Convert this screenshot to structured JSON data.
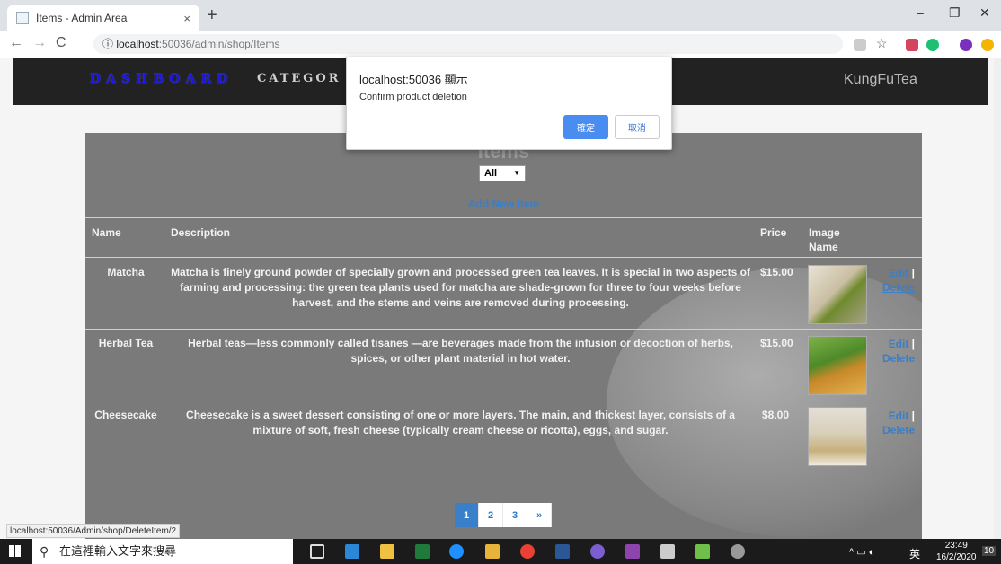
{
  "browser": {
    "tab_title": "Items - Admin Area",
    "tab_close": "×",
    "new_tab": "+",
    "url_host": "localhost",
    "url_path": ":50036/admin/shop/Items",
    "minimize": "–",
    "restore": "❐",
    "close": "✕"
  },
  "site": {
    "brand": "DASHBOARD",
    "nav_categories": "CATEGOR",
    "store_name": "KungFuTea"
  },
  "items_panel": {
    "title": "Items",
    "filter_value": "All",
    "add_new": "Add New Item",
    "headers": {
      "name": "Name",
      "description": "Description",
      "price": "Price",
      "image": "Image Name"
    },
    "rows": [
      {
        "name": "Matcha",
        "description": "Matcha is finely ground powder of specially grown and processed green tea leaves. It is special in two aspects of farming and processing: the green tea plants used for matcha are shade-grown for three to four weeks before harvest, and the stems and veins are removed during processing.",
        "price": "$15.00",
        "edit": "Edit",
        "delete": "Delete"
      },
      {
        "name": "Herbal Tea",
        "description": "Herbal teas—less commonly called tisanes —are beverages made from the infusion or decoction of herbs, spices, or other plant material in hot water.",
        "price": "$15.00",
        "edit": "Edit",
        "delete": "Delete"
      },
      {
        "name": "Cheesecake",
        "description": "Cheesecake is a sweet dessert consisting of one or more layers. The main, and thickest layer, consists of a mixture of soft, fresh cheese (typically cream cheese or ricotta), eggs, and sugar.",
        "price": "$8.00",
        "edit": "Edit",
        "delete": "Delete"
      }
    ],
    "pagination": [
      "1",
      "2",
      "3",
      "»"
    ]
  },
  "dialog": {
    "title": "localhost:50036 顯示",
    "message": "Confirm product deletion",
    "ok": "確定",
    "cancel": "取消"
  },
  "status_bar": "localhost:50036/Admin/shop/DeleteItem/2",
  "taskbar": {
    "search_placeholder": "在這裡輸入文字來搜尋",
    "ime": "英",
    "time": "23:49",
    "date": "16/2/2020",
    "notifications": "10"
  }
}
